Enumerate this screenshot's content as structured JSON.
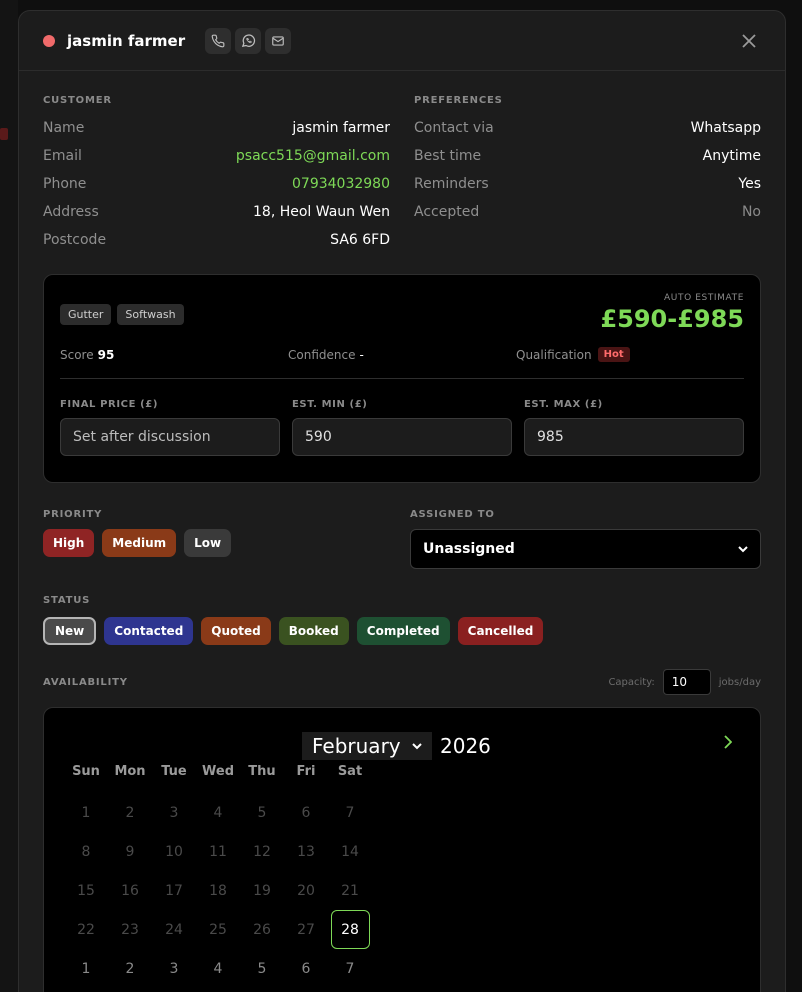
{
  "header": {
    "title": "jasmin farmer",
    "status_color": "#f06a6a",
    "actions": [
      {
        "icon": "phone-icon"
      },
      {
        "icon": "whatsapp-icon"
      },
      {
        "icon": "mail-icon"
      }
    ],
    "close_icon": "close-icon"
  },
  "customer": {
    "label": "CUSTOMER",
    "rows": [
      {
        "key": "Name",
        "value": "jasmin farmer"
      },
      {
        "key": "Email",
        "value": "psacc515@gmail.com"
      },
      {
        "key": "Phone",
        "value": "07934032980"
      },
      {
        "key": "Address",
        "value": "18, Heol Waun Wen"
      },
      {
        "key": "Postcode",
        "value": "SA6 6FD"
      }
    ]
  },
  "preferences": {
    "label": "PREFERENCES",
    "rows": [
      {
        "key": "Contact via",
        "value": "Whatsapp"
      },
      {
        "key": "Best time",
        "value": "Anytime"
      },
      {
        "key": "Reminders",
        "value": "Yes"
      },
      {
        "key": "Accepted",
        "value": "No"
      }
    ]
  },
  "estimate": {
    "tags": [
      "Gutter",
      "Softwash"
    ],
    "auto_label": "AUTO ESTIMATE",
    "auto_value": "£590-£985",
    "score_label": "Score",
    "score_value": "95",
    "confidence_label": "Confidence",
    "confidence_value": "-",
    "qualification_label": "Qualification",
    "qualification_value": "Hot",
    "final_price_label": "FINAL PRICE (£)",
    "final_price_placeholder": "Set after discussion",
    "est_min_label": "EST. MIN (£)",
    "est_min_value": "590",
    "est_max_label": "EST. MAX (£)",
    "est_max_value": "985"
  },
  "priority": {
    "label": "PRIORITY",
    "options": [
      {
        "label": "High",
        "color": "#8f2424"
      },
      {
        "label": "Medium",
        "color": "#8a3a18"
      },
      {
        "label": "Low",
        "color": "#3a3a3a"
      }
    ]
  },
  "assigned": {
    "label": "ASSIGNED TO",
    "value": "Unassigned"
  },
  "status": {
    "label": "STATUS",
    "selected": "New",
    "options": [
      {
        "label": "New",
        "color": "#4a4a4a"
      },
      {
        "label": "Contacted",
        "color": "#2e3590"
      },
      {
        "label": "Quoted",
        "color": "#8a3a18"
      },
      {
        "label": "Booked",
        "color": "#3a5220"
      },
      {
        "label": "Completed",
        "color": "#1e5032"
      },
      {
        "label": "Cancelled",
        "color": "#8a2020"
      }
    ]
  },
  "availability": {
    "label": "AVAILABILITY",
    "capacity_label": "Capacity:",
    "capacity_value": "10",
    "capacity_unit": "jobs/day"
  },
  "calendar": {
    "month": "February",
    "year": "2026",
    "weekdays": [
      "Sun",
      "Mon",
      "Tue",
      "Wed",
      "Thu",
      "Fri",
      "Sat"
    ],
    "weeks": [
      [
        "1",
        "2",
        "3",
        "4",
        "5",
        "6",
        "7"
      ],
      [
        "8",
        "9",
        "10",
        "11",
        "12",
        "13",
        "14"
      ],
      [
        "15",
        "16",
        "17",
        "18",
        "19",
        "20",
        "21"
      ],
      [
        "22",
        "23",
        "24",
        "25",
        "26",
        "27",
        "28"
      ],
      [
        "1",
        "2",
        "3",
        "4",
        "5",
        "6",
        "7"
      ]
    ],
    "selected_day": "28"
  }
}
